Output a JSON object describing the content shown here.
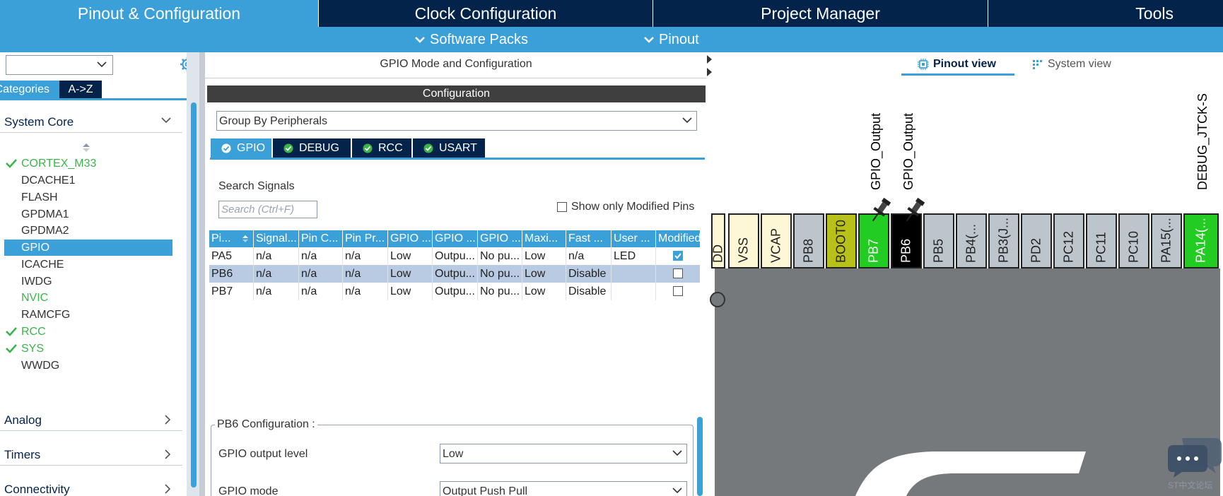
{
  "top_tabs": [
    "Pinout & Configuration",
    "Clock Configuration",
    "Project Manager",
    "Tools"
  ],
  "sub_menu": [
    "Software Packs",
    "Pinout"
  ],
  "left": {
    "category_tabs": [
      "Categories",
      "A->Z"
    ],
    "sections": [
      "System Core",
      "Analog",
      "Timers",
      "Connectivity"
    ],
    "core_items": [
      "CORTEX_M33",
      "DCACHE1",
      "FLASH",
      "GPDMA1",
      "GPDMA2",
      "GPIO",
      "ICACHE",
      "IWDG",
      "NVIC",
      "RAMCFG",
      "RCC",
      "SYS",
      "WWDG"
    ]
  },
  "middle": {
    "title": "GPIO Mode and Configuration",
    "config_bar": "Configuration",
    "group_select": "Group By Peripherals",
    "peripheral_tabs": [
      "GPIO",
      "DEBUG",
      "RCC",
      "USART"
    ],
    "search_label": "Search Signals",
    "search_placeholder": "Search (Ctrl+F)",
    "show_modified": "Show only Modified Pins",
    "columns": [
      "Pi...",
      "Signal...",
      "Pin C...",
      "Pin Pr...",
      "GPIO ...",
      "GPIO ...",
      "GPIO ...",
      "Maxi...",
      "Fast ...",
      "User ...",
      "Modified"
    ],
    "rows": [
      {
        "pin": "PA5",
        "signal": "n/a",
        "pin_context": "n/a",
        "pin_privilege": "n/a",
        "output_level": "Low",
        "mode": "Outpu...",
        "pull": "No pu...",
        "speed": "Low",
        "fast": "n/a",
        "user_label": "LED",
        "modified": true
      },
      {
        "pin": "PB6",
        "signal": "n/a",
        "pin_context": "n/a",
        "pin_privilege": "n/a",
        "output_level": "Low",
        "mode": "Outpu...",
        "pull": "No pu...",
        "speed": "Low",
        "fast": "Disable",
        "user_label": "",
        "modified": false
      },
      {
        "pin": "PB7",
        "signal": "n/a",
        "pin_context": "n/a",
        "pin_privilege": "n/a",
        "output_level": "Low",
        "mode": "Outpu...",
        "pull": "No pu...",
        "speed": "Low",
        "fast": "Disable",
        "user_label": "",
        "modified": false
      }
    ],
    "pb6_title": "PB6 Configuration :",
    "pb6_fields": [
      {
        "label": "GPIO output level",
        "value": "Low"
      },
      {
        "label": "GPIO mode",
        "value": "Output Push Pull"
      }
    ]
  },
  "right": {
    "views": [
      "Pinout view",
      "System view"
    ],
    "pins": [
      "DD",
      "VSS",
      "VCAP",
      "PB8",
      "BOOT0",
      "PB7",
      "PB6",
      "PB5",
      "PB4(...",
      "PB3(J...",
      "PD2",
      "PC12",
      "PC11",
      "PC10",
      "PA15(...",
      "PA14(..."
    ],
    "signal_labels": [
      "GPIO_Output",
      "GPIO_Output",
      "DEBUG_JTCK-S"
    ],
    "watermark": "ST中文论坛"
  },
  "colors": {
    "navy": "#03234b",
    "accent": "#3ca0d8",
    "pin_green": "#22cc22",
    "pin_olive": "#b7c11a",
    "pin_pale": "#fdf7d6",
    "pin_grey": "#bcc4cc",
    "chip": "#76797c"
  }
}
